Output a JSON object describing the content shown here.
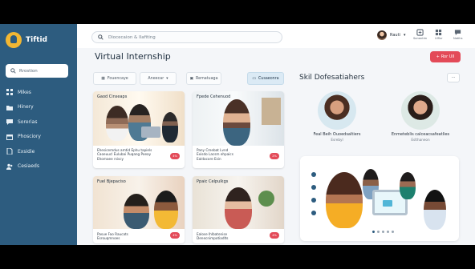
{
  "app": {
    "name": "Tiftid"
  },
  "sidebar": {
    "search_label": "Rrostion",
    "items": [
      {
        "label": "Mikes",
        "icon": "grid-icon"
      },
      {
        "label": "Hinery",
        "icon": "folder-icon"
      },
      {
        "label": "Sorerias",
        "icon": "chat-icon"
      },
      {
        "label": "Phosciory",
        "icon": "calendar-icon"
      },
      {
        "label": "Exsidie",
        "icon": "document-icon"
      },
      {
        "label": "Cesiaeds",
        "icon": "people-icon"
      }
    ]
  },
  "topbar": {
    "search_placeholder": "Diocecaion & Ilafiting",
    "user_name": "Rauti",
    "icon_labels": [
      "Sonantim",
      "Ulflur",
      "Notihs"
    ]
  },
  "page": {
    "title": "Virtual Internship",
    "primary_action": "Ror UII"
  },
  "tabs": [
    {
      "label": "Fouencaye",
      "icon": "grid-icon"
    },
    {
      "label": "Aneecar",
      "icon": "chevron-down-icon"
    },
    {
      "label": "Rematuaga",
      "icon": "briefcase-icon"
    },
    {
      "label": "Cusaeonra",
      "icon": "box-icon"
    }
  ],
  "cards": [
    {
      "title": "Gaod Cinseaps",
      "meta": [
        "Ehesicemdus amtid Ephu tapiels",
        "Caoeuucl Eulubai Puqang Poeay",
        "Ehomaee rsiscy"
      ],
      "badge": "4%"
    },
    {
      "title": "Fpede Cehenuod",
      "meta": [
        "Pany Cmebat Lvnd",
        "Exisdo Lacsm ehpaics",
        "Ealdacore Esin"
      ],
      "badge": "2%"
    },
    {
      "title": "Fuel Bjepaciso",
      "meta": [
        "Pasue Fao Raucats",
        "Esrouqmnoes"
      ],
      "badge": "4%"
    },
    {
      "title": "Ppaic Celpulkgs",
      "meta": [
        "Ealose Ihlbatenise",
        "Denecnimpotiadlts"
      ],
      "badge": "4%"
    }
  ],
  "experts": {
    "title": "Skil Dofesatiahers",
    "items": [
      {
        "name": "Feal Beih Ouoedsaltiers",
        "role": "Esrebyl"
      },
      {
        "name": "Enmeteblis calceacsafeatlies",
        "role": "Eslthaneon"
      }
    ]
  },
  "colors": {
    "sidebar": "#2d5c7f",
    "accent": "#e34a58",
    "logo": "#f2b733",
    "active_tab": "#dbeaf5"
  }
}
